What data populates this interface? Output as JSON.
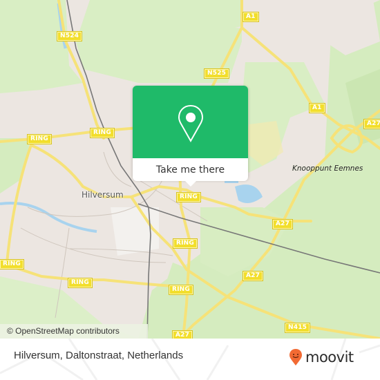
{
  "map": {
    "place_labels": [
      {
        "id": "hilversum",
        "text": "Hilversum"
      }
    ],
    "junction_labels": [
      {
        "id": "knooppunt-eemnes",
        "text": "Knooppunt Eemnes"
      }
    ],
    "road_shields": [
      {
        "id": "n524",
        "text": "N524"
      },
      {
        "id": "a1-top",
        "text": "A1"
      },
      {
        "id": "n525",
        "text": "N525"
      },
      {
        "id": "a1-mid",
        "text": "A1"
      },
      {
        "id": "a27-right",
        "text": "A27"
      },
      {
        "id": "ring-left-top",
        "text": "RING"
      },
      {
        "id": "ring-center-top",
        "text": "RING"
      },
      {
        "id": "ring-popup",
        "text": "RING"
      },
      {
        "id": "a27-mid",
        "text": "A27"
      },
      {
        "id": "ring-mid",
        "text": "RING"
      },
      {
        "id": "ring-left",
        "text": "RING"
      },
      {
        "id": "a27-lower",
        "text": "A27"
      },
      {
        "id": "ring-bottom-left",
        "text": "RING"
      },
      {
        "id": "ring-bottom",
        "text": "RING"
      },
      {
        "id": "n415",
        "text": "N415"
      },
      {
        "id": "a27-bottom",
        "text": "A27"
      }
    ],
    "attribution": "© OpenStreetMap contributors"
  },
  "popup": {
    "icon": "map-pin-icon",
    "button_label": "Take me there",
    "color": "#1fba69"
  },
  "footer": {
    "address": "Hilversum, Daltonstraat, Netherlands",
    "brand": "moovit",
    "brand_color": "#f26a33"
  }
}
